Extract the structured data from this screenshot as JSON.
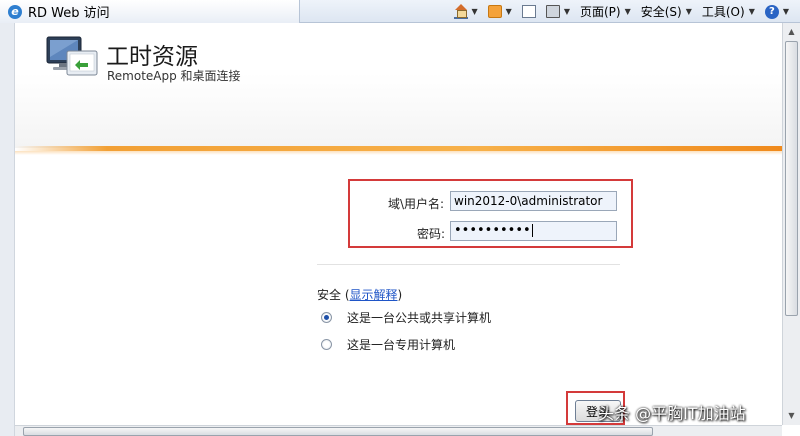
{
  "browser": {
    "tab_title": "RD Web 访问",
    "toolbar": {
      "page_menu": "页面(P)",
      "security_menu": "安全(S)",
      "tools_menu": "工具(O)"
    }
  },
  "header": {
    "title": "工时资源",
    "subtitle": "RemoteApp 和桌面连接"
  },
  "login_form": {
    "username_label": "域\\用户名:",
    "username_value": "win2012-0\\administrator",
    "password_label": "密码:",
    "password_value": "••••••••••"
  },
  "security": {
    "label": "安全 (",
    "link": "显示解释",
    "label_close": ")",
    "options": [
      {
        "label": "这是一台公共或共享计算机",
        "checked": true
      },
      {
        "label": "这是一台专用计算机",
        "checked": false
      }
    ]
  },
  "actions": {
    "login_label": "登录"
  },
  "watermark": {
    "text": "头条 @平胸IT加油站"
  },
  "colors": {
    "accent_orange": "#f2a035",
    "highlight_red": "#d43a3a",
    "link_blue": "#1f55c7"
  }
}
